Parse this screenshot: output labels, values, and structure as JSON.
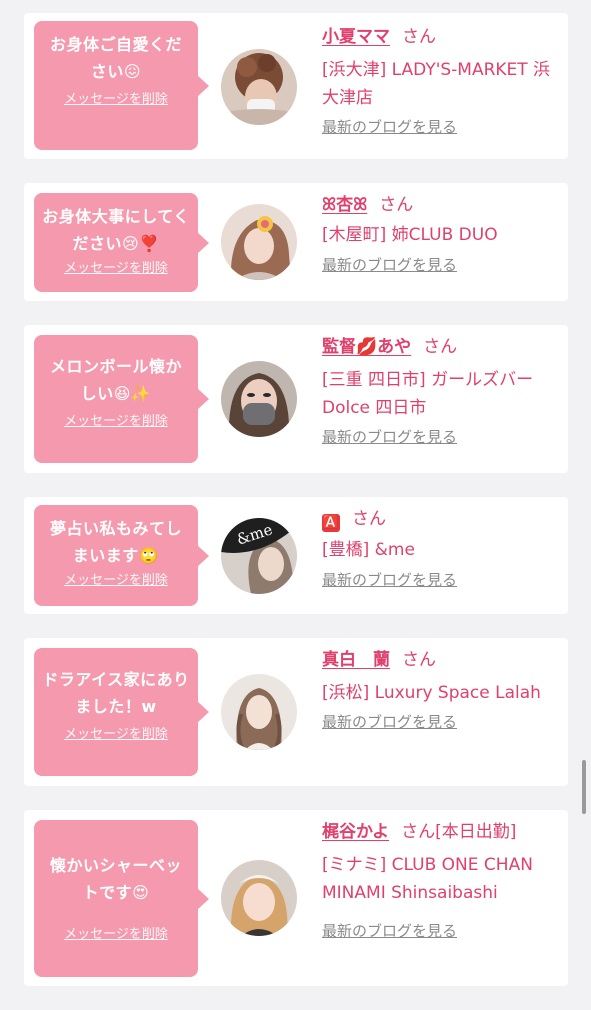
{
  "cards": [
    {
      "message": "お身体ご自愛ください😖",
      "delete_label": "メッセージを削除",
      "name": "小夏ママ",
      "honorific": "さん",
      "shop": "[浜大津] LADY'S-MARKET 浜大津店",
      "blog_link": "最新のブログを見る",
      "avatar_icon": "photo-avatar-brown-hair"
    },
    {
      "message": "お身体大事にしてください😢❣️",
      "delete_label": "メッセージを削除",
      "name": "ꕤ杏ꕤ",
      "honorific": "さん",
      "shop": "[木屋町] 姉CLUB DUO",
      "blog_link": "最新のブログを見る",
      "avatar_icon": "photo-avatar-brown-hair"
    },
    {
      "message": "メロンボール懐かしい😆✨",
      "delete_label": "メッセージを削除",
      "name": "監督💋あや",
      "honorific": "さん",
      "shop": "[三重 四日市] ガールズバー Dolce 四日市",
      "blog_link": "最新のブログを見る",
      "avatar_icon": "photo-avatar-masked"
    },
    {
      "message": "夢占い私もみてしまいます🙄",
      "delete_label": "メッセージを削除",
      "name": "🅰️",
      "honorific": "さん",
      "shop": "[豊橋] &me",
      "blog_link": "最新のブログを見る",
      "avatar_icon": "photo-avatar-andme"
    },
    {
      "message": "ドラアイス家にありました！w",
      "delete_label": "メッセージを削除",
      "name": "真白　蘭",
      "honorific": "さん",
      "shop": "[浜松] Luxury Space Lalah",
      "blog_link": "最新のブログを見る",
      "avatar_icon": "photo-avatar-braided"
    },
    {
      "message": "懐かいシャーベットです😍",
      "delete_label": "メッセージを削除",
      "name": "梶谷かよ",
      "honorific": "さん[本日出勤]",
      "shop": "[ミナミ] CLUB ONE CHAN MINAMI Shinsaibashi",
      "blog_link": "最新のブログを見る",
      "avatar_icon": "photo-avatar-blonde"
    }
  ],
  "colors": {
    "accent_pink": "#e0416c",
    "bubble_pink": "#f59aae",
    "link_gray": "#8a8a8a",
    "background": "#f2f2f4"
  }
}
